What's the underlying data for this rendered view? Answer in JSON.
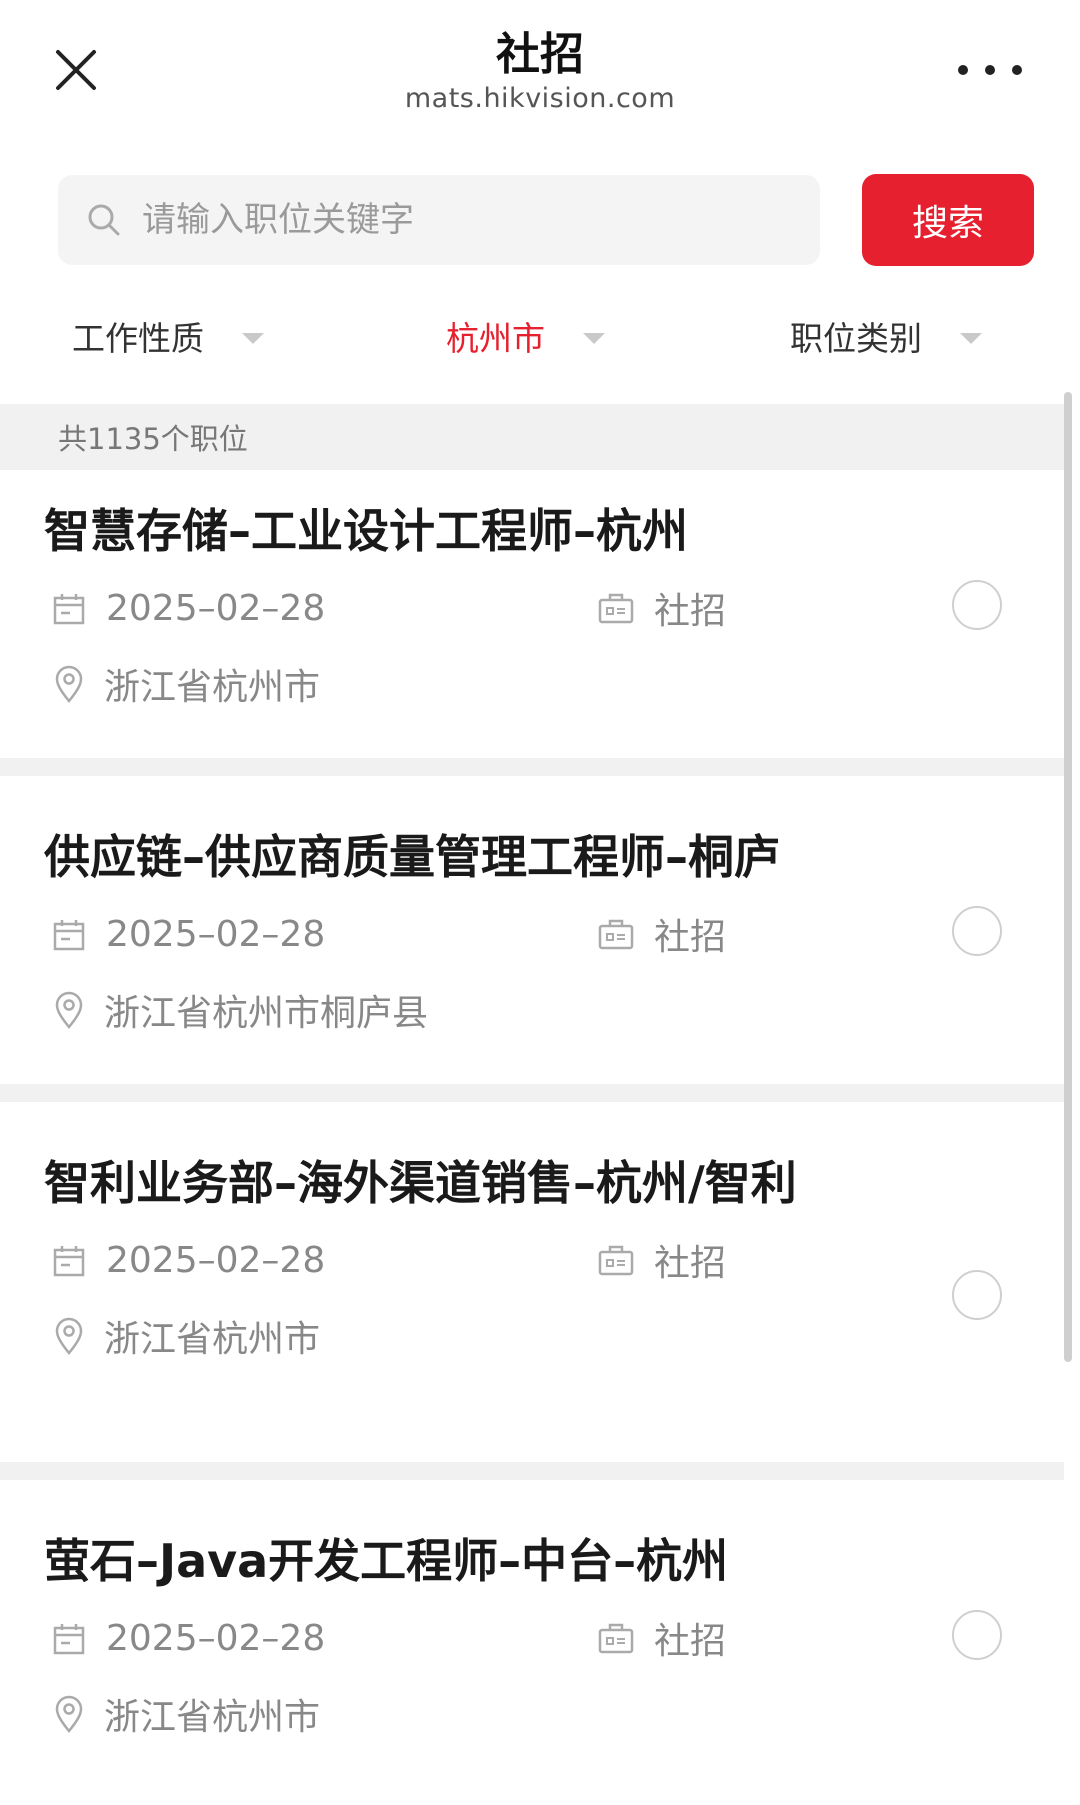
{
  "header": {
    "title": "社招",
    "domain": "mats.hikvision.com"
  },
  "search": {
    "placeholder": "请输入职位关键字",
    "button_label": "搜索"
  },
  "filters": [
    {
      "label": "工作性质",
      "active": false
    },
    {
      "label": "杭州市",
      "active": true
    },
    {
      "label": "职位类别",
      "active": false
    }
  ],
  "count_label": "共1135个职位",
  "colors": {
    "accent": "#e6202e"
  },
  "jobs": [
    {
      "title": "智慧存储–工业设计工程师–杭州",
      "date": "2025–02–28",
      "type": "社招",
      "location": "浙江省杭州市"
    },
    {
      "title": "供应链–供应商质量管理工程师–桐庐",
      "date": "2025–02–28",
      "type": "社招",
      "location": "浙江省杭州市桐庐县"
    },
    {
      "title": "智利业务部–海外渠道销售–杭州/智利",
      "date": "2025–02–28",
      "type": "社招",
      "location": "浙江省杭州市"
    },
    {
      "title": "萤石–Java开发工程师–中台–杭州",
      "date": "2025–02–28",
      "type": "社招",
      "location": "浙江省杭州市"
    }
  ]
}
